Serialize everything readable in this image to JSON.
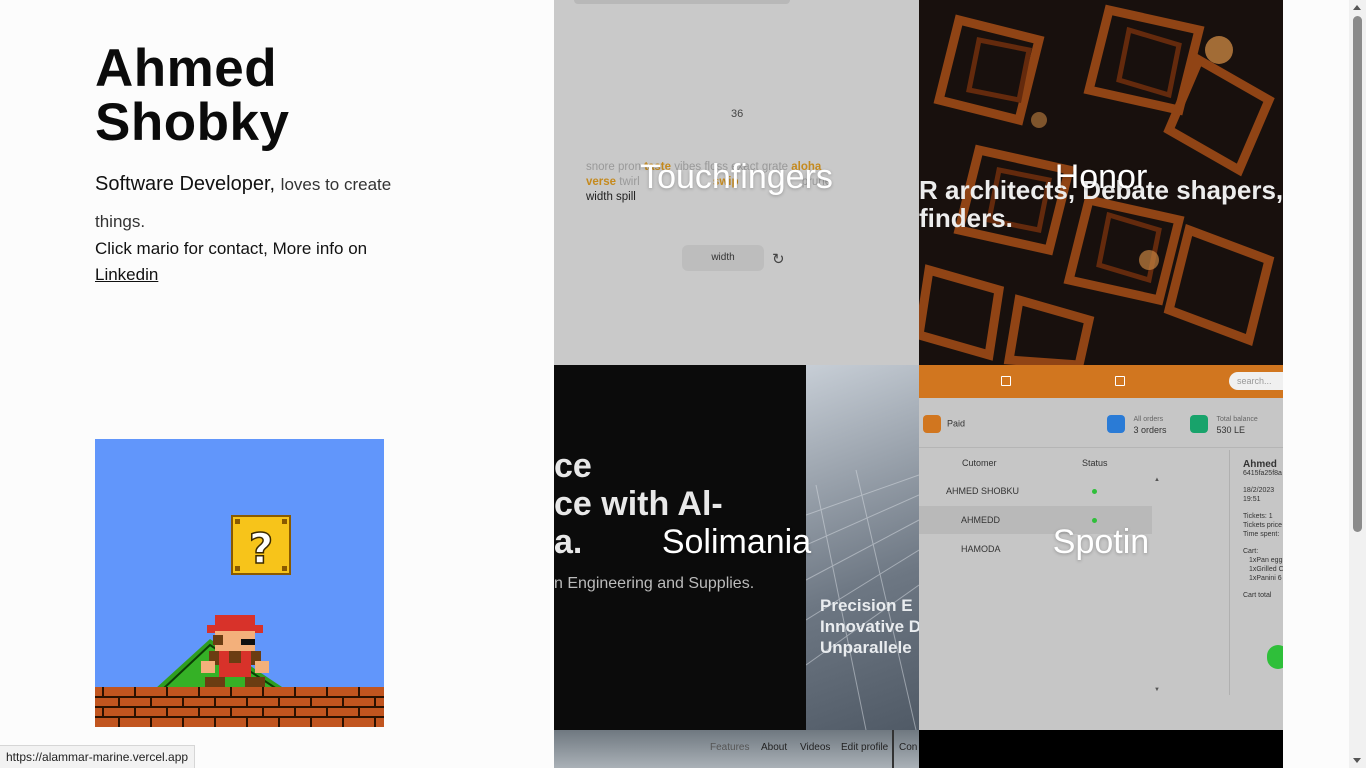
{
  "profile": {
    "first_name": "Ahmed",
    "last_name": "Shobky",
    "role": "Software Developer,",
    "tagline": "loves to create things.",
    "contact_text": "Click mario for contact, More info on",
    "linkedin_label": "Linkedin"
  },
  "status_url": "https://alammar-marine.vercel.app",
  "projects": [
    {
      "title": "Touchfingers"
    },
    {
      "title": "Honor"
    },
    {
      "title": "Solimania"
    },
    {
      "title": "Spotin"
    }
  ],
  "touchfingers": {
    "counter": "36",
    "words_line1_a": "snore pron",
    "words_line1_b": "taste",
    "words_line1_c": "vibes",
    "words_line1_d": "floss exact grate",
    "words_line1_e": "aloha",
    "words_line2_a": "verse",
    "words_line2_b": "twirl",
    "words_line2_c": "swip",
    "words_line2_d": "prune",
    "words_line3": "width spill",
    "input_value": "width"
  },
  "honor": {
    "line1": "R architects, Debate shapers, a",
    "line2": "finders."
  },
  "solimania": {
    "big_line1": "ce",
    "big_line2": "ce with Al-",
    "big_line3": "a.",
    "subtitle": "n Engineering and Supplies.",
    "panel_line1": "Precision E",
    "panel_line2": "Innovative D",
    "panel_line3": "Unparallele"
  },
  "spotin": {
    "search_placeholder": "search...",
    "paid_label": "Paid",
    "all_orders_label": "All orders",
    "all_orders_value": "3 orders",
    "total_balance_label": "Total balance",
    "total_balance_value": "530 LE",
    "col_customer": "Cutomer",
    "col_status": "Status",
    "rows": [
      "AHMED SHOBKU",
      "AHMEDD",
      "HAMODA"
    ],
    "detail_name": "Ahmed",
    "detail_id": "6415fa25f8a",
    "detail_date": "18/2/2023",
    "detail_time": "19:51",
    "tickets": "Tickets: 1",
    "tickets_price": "Tickets price",
    "time_spent": "Time spent:",
    "cart": "Cart:",
    "cart_item1": "1xPan egg",
    "cart_item2": "1xGrilled C",
    "cart_item3": "1xPanini 6",
    "cart_total": "Cart total"
  },
  "alammar_nav": [
    "Features",
    "About",
    "Videos",
    "Edit profile",
    "Con"
  ],
  "colors": {
    "mario_sky": "#6196fb",
    "spotin_orange": "#d1761f",
    "touchfingers_highlight": "#c58a1e"
  }
}
